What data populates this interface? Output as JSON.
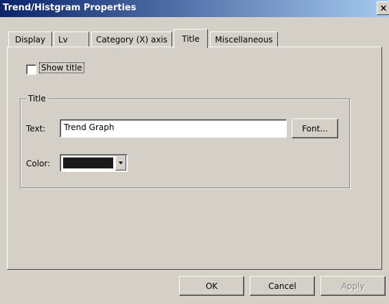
{
  "window": {
    "title": "Trend/Histgram Properties",
    "close_label": "×"
  },
  "tabs": [
    {
      "label": "Display",
      "selected": false
    },
    {
      "label": "Lv",
      "selected": false
    },
    {
      "label": "Category (X) axis",
      "selected": false
    },
    {
      "label": "Title",
      "selected": true
    },
    {
      "label": "Miscellaneous",
      "selected": false
    }
  ],
  "show_title": {
    "label": "Show title",
    "checked": false
  },
  "title_group": {
    "label": "Title",
    "text_label": "Text:",
    "text_value": "Trend Graph",
    "font_button": "Font...",
    "color_label": "Color:",
    "color_value": "#1a1a1a"
  },
  "footer": {
    "ok": "OK",
    "cancel": "Cancel",
    "apply": "Apply"
  },
  "icons": {
    "close": "close-icon",
    "dropdown": "chevron-down-icon"
  },
  "colors": {
    "titlebar_start": "#0a246a",
    "titlebar_end": "#a6caf0",
    "face": "#d4d0c8"
  }
}
